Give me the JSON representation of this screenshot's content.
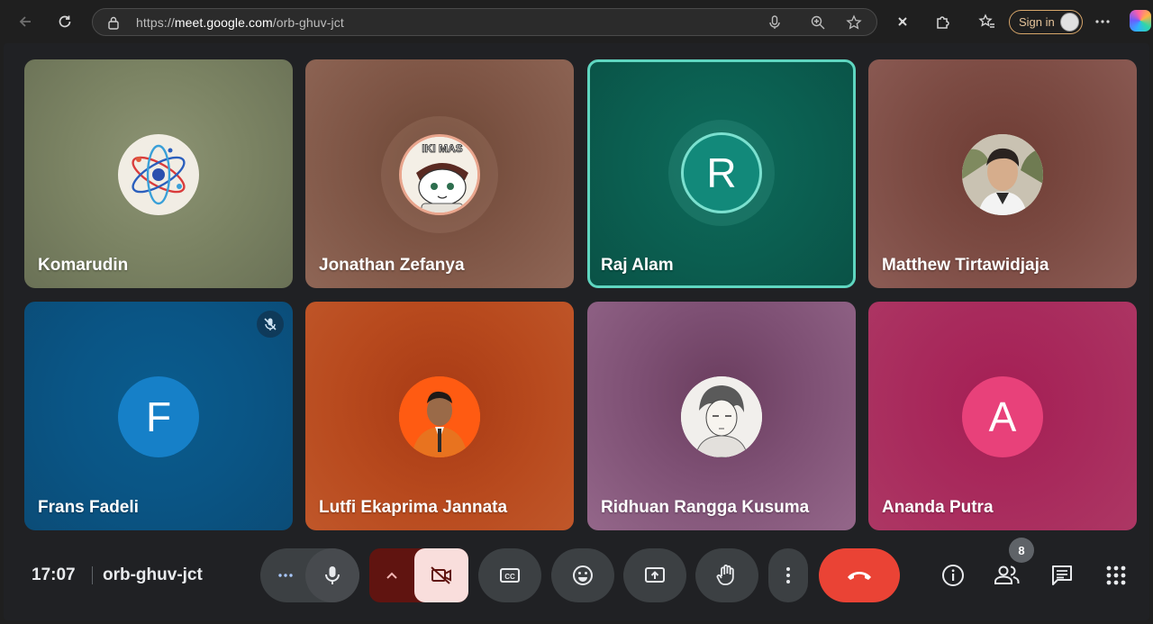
{
  "browser": {
    "url_prefix": "https://",
    "url_host": "meet.google.com",
    "url_path": "/orb-ghuv-jct",
    "signin_label": "Sign in"
  },
  "participants": [
    {
      "name": "Komarudin",
      "avatar": "atom-logo-icon",
      "letter": ""
    },
    {
      "name": "Jonathan Zefanya",
      "avatar": "cartoon-meme-avatar",
      "letter": "",
      "avatar_text": "IKI MAS"
    },
    {
      "name": "Raj Alam",
      "avatar": "letter",
      "letter": "R",
      "speaking": true
    },
    {
      "name": "Matthew Tirtawidjaja",
      "avatar": "photo-avatar",
      "letter": ""
    },
    {
      "name": "Frans Fadeli",
      "avatar": "letter",
      "letter": "F",
      "muted": true
    },
    {
      "name": "Lutfi Ekaprima Jannata",
      "avatar": "photo-avatar",
      "letter": ""
    },
    {
      "name": "Ridhuan Rangga Kusuma",
      "avatar": "anime-sketch-avatar",
      "letter": ""
    },
    {
      "name": "Ananda Putra",
      "avatar": "letter",
      "letter": "A"
    }
  ],
  "meeting": {
    "time": "17:07",
    "code": "orb-ghuv-jct",
    "participant_count": "8"
  },
  "colors": {
    "speaking_border": "#5fd6c0",
    "end_call": "#ea4335",
    "camera_off_bg": "#f9dedc",
    "camera_arrow_bg": "#601410"
  }
}
